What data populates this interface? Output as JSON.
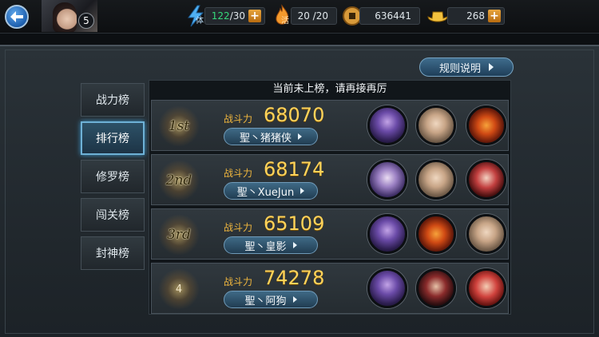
{
  "topbar": {
    "level": "5",
    "stamina": {
      "icon": "stamina-bolt-icon",
      "char": "体",
      "value": "122",
      "max": "/30"
    },
    "vitality": {
      "icon": "vitality-flame-icon",
      "char": "活",
      "value": "20 /20"
    },
    "coins": {
      "icon": "coin-icon",
      "value": "636441"
    },
    "ingots": {
      "icon": "gold-ingot-icon",
      "value": "268"
    }
  },
  "rules_button": "规则说明",
  "tabs": [
    "战力榜",
    "排行榜",
    "修罗榜",
    "闯关榜",
    "封神榜"
  ],
  "active_tab": "排行榜",
  "notice": "当前未上榜，请再接再厉",
  "power_label": "战斗力",
  "rows": [
    {
      "rank": "1st",
      "power": "68070",
      "name": "聖丶猪猪侠",
      "heroes": [
        "purple-demon-hero",
        "white-hair-hero",
        "fire-beast-hero"
      ]
    },
    {
      "rank": "2nd",
      "power": "68174",
      "name": "聖丶XueJun",
      "heroes": [
        "lavender-maiden-hero",
        "white-hair-hero",
        "red-lady-hero"
      ]
    },
    {
      "rank": "3rd",
      "power": "65109",
      "name": "聖丶皇影",
      "heroes": [
        "purple-demon-hero",
        "fire-beast-hero",
        "white-hair-hero"
      ]
    },
    {
      "rank": "4",
      "power": "74278",
      "name": "聖丶阿狗",
      "heroes": [
        "purple-demon-hero",
        "crimson-warrior-hero",
        "red-girl-hero"
      ]
    }
  ],
  "colors": {
    "accent_gold": "#ffd35a",
    "active_tab": "#6eb1d6",
    "stamina": "#35d87a"
  }
}
